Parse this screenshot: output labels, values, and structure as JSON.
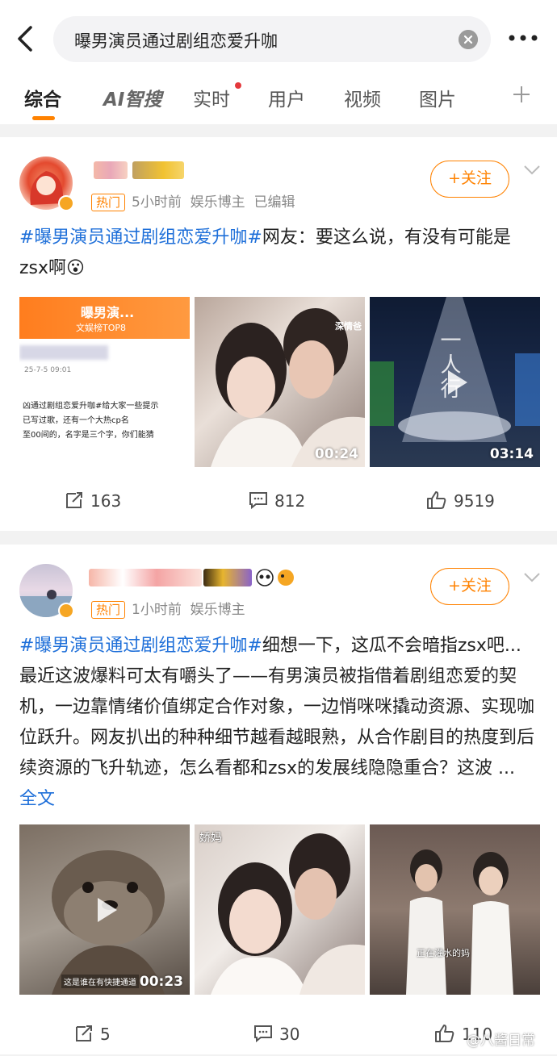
{
  "search": {
    "query": "曝男演员通过剧组恋爱升咖"
  },
  "tabs": [
    {
      "label": "综合"
    },
    {
      "label": "AI智搜"
    },
    {
      "label": "实时"
    },
    {
      "label": "用户"
    },
    {
      "label": "视频"
    },
    {
      "label": "图片"
    }
  ],
  "posts": [
    {
      "badge": "热门",
      "time": "5小时前",
      "role": "娱乐博主",
      "edited": "已编辑",
      "follow_label": "+关注",
      "hashtag": "#曝男演员通过剧组恋爱升咖#",
      "text": "网友：要这么说，有没有可能是zsx啊",
      "emoji": "😮",
      "images": [
        {
          "title": "曝男演...",
          "subtitle": "文娱榜TOP8",
          "date": "25-7-5 09:01",
          "line1": "凶通过剧组恋爱升咖#给大家一些提示",
          "line2": "已写过歌，还有一个大热cp名",
          "line3": "至00间的，名字是三个字，你们能猜"
        },
        {
          "duration": "00:24",
          "overlay": "深情爸"
        },
        {
          "duration": "03:14",
          "overlay": "一人行"
        }
      ],
      "reposts": "163",
      "comments": "812",
      "likes": "9519"
    },
    {
      "badge": "热门",
      "time": "1小时前",
      "role": "娱乐博主",
      "follow_label": "+关注",
      "hashtag": "#曝男演员通过剧组恋爱升咖#",
      "text": "细想一下，这瓜不会暗指zsx吧...最近这波爆料可太有嚼头了——有男演员被指借着剧组恋爱的契机，一边靠情绪价值绑定合作对象，一边悄咪咪撬动资源、实现咖位跃升。网友扒出的种种细节越看越眼熟，从合作剧目的热度到后续资源的飞升轨迹，怎么看都和zsx的发展线隐隐重合？这波 ... ",
      "full_text": "全文",
      "images": [
        {
          "duration": "00:23",
          "caption": "这是谁在有快捷通道"
        },
        {
          "overlay": "娇妈"
        },
        {
          "caption": "正在灌水的妈"
        }
      ],
      "reposts": "5",
      "comments": "30",
      "likes": "110"
    }
  ],
  "watermark": "@八酱日常",
  "colors": {
    "accent": "#ff8200",
    "link": "#1e6fd9"
  }
}
